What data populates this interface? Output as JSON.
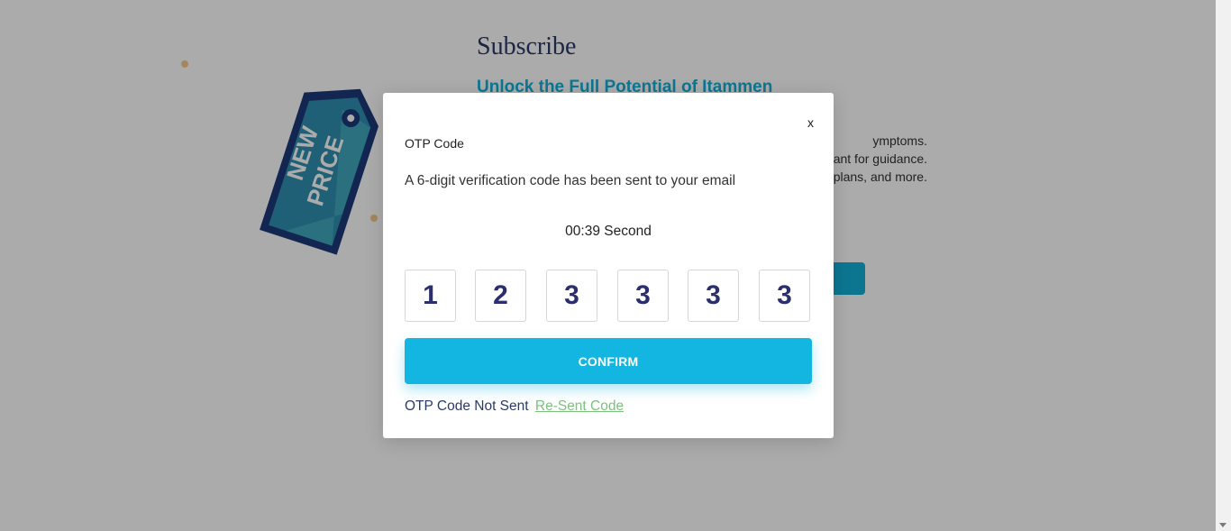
{
  "background": {
    "title": "Subscribe",
    "subtitle": "Unlock the Full Potential of Itammen",
    "features": [
      "ymptoms.",
      "ant for guidance.",
      "plans, and more."
    ],
    "tag_text_line1": "NEW",
    "tag_text_line2": "PRICE"
  },
  "modal": {
    "close_label": "x",
    "title": "OTP Code",
    "description": "A 6-digit verification code has been sent to your email",
    "timer": "00:39 Second",
    "otp_digits": [
      "1",
      "2",
      "3",
      "3",
      "3",
      "3"
    ],
    "confirm_label": "CONFIRM",
    "not_sent_text": "OTP Code Not Sent",
    "resend_label": "Re-Sent Code"
  },
  "colors": {
    "accent": "#13b6e0",
    "title_text": "#2b3a67",
    "digit_text": "#2b2f6e",
    "resend_link": "#7cc17e",
    "overlay": "rgba(0,0,0,0.33)"
  }
}
